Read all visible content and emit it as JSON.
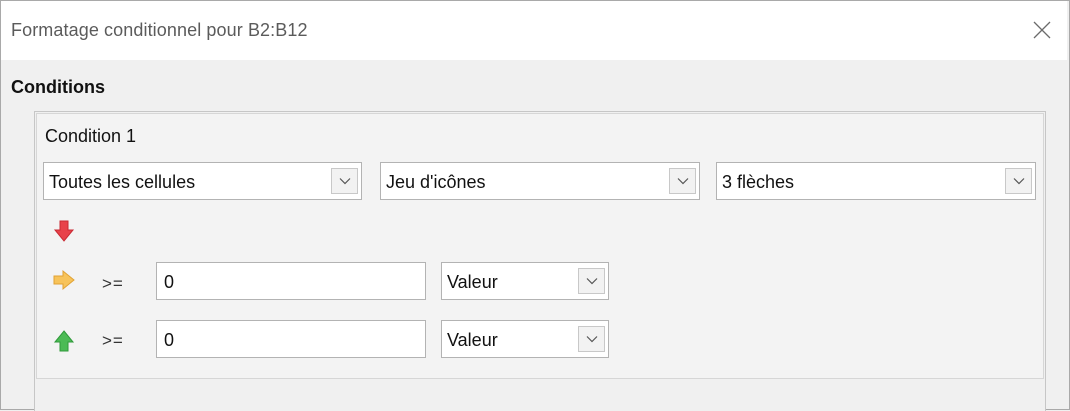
{
  "dialog": {
    "title": "Formatage conditionnel pour B2:B12",
    "close_icon": "close-icon"
  },
  "conditions": {
    "section_label": "Conditions",
    "condition_label": "Condition 1",
    "scope_select": "Toutes les cellules",
    "type_select": "Jeu d'icônes",
    "iconset_select": "3 flèches",
    "rows": [
      {
        "icon": "arrow-down-red-icon",
        "icon_color": "#e8424a"
      },
      {
        "icon": "arrow-right-yellow-icon",
        "icon_color": "#f5b843",
        "operator": ">=",
        "value": "0",
        "unit": "Valeur"
      },
      {
        "icon": "arrow-up-green-icon",
        "icon_color": "#3fae49",
        "operator": ">=",
        "value": "0",
        "unit": "Valeur"
      }
    ]
  }
}
